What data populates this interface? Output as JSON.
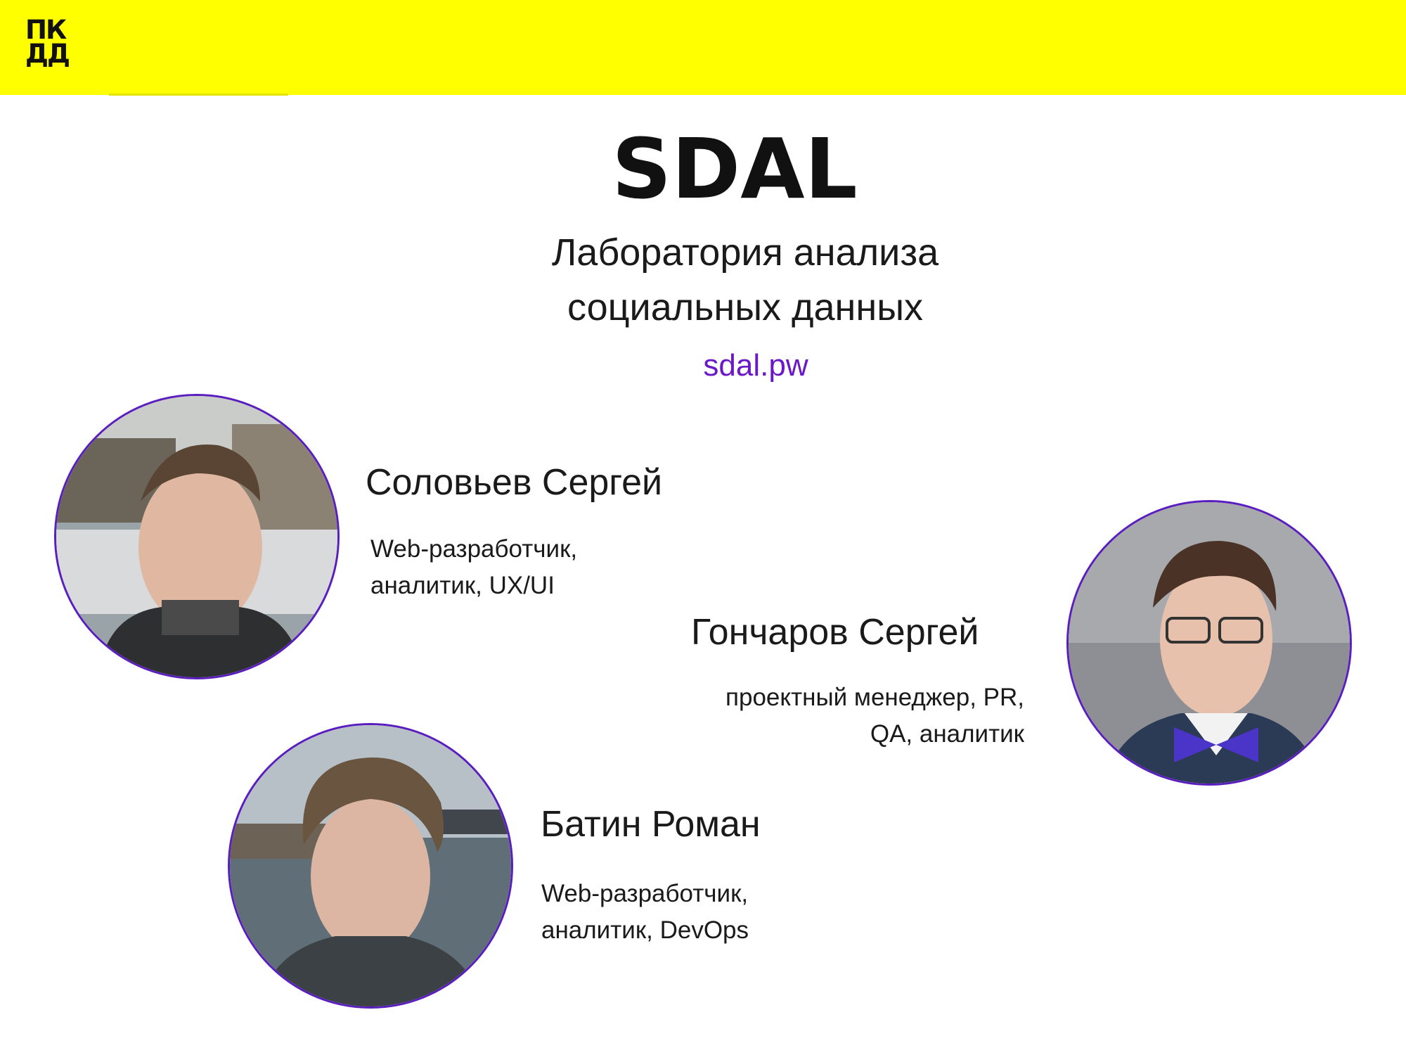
{
  "header": {
    "bar_color": "#ffff00",
    "logo": {
      "line1": "ПК",
      "line2": "ДД"
    }
  },
  "slide": {
    "title": "SDAL",
    "subtitle_line1": "Лаборатория анализа",
    "subtitle_line2": "социальных данных",
    "website": "sdal.pw",
    "website_color": "#6a18c8"
  },
  "team": [
    {
      "name": "Соловьев Сергей",
      "role_line1": "Web-разработчик,",
      "role_line2": "аналитик, UX/UI"
    },
    {
      "name": "Гончаров Сергей",
      "role_line1": "проектный менеджер, PR,",
      "role_line2": "QA, аналитик"
    },
    {
      "name": "Батин Роман",
      "role_line1": "Web-разработчик,",
      "role_line2": "аналитик, DevOps"
    }
  ],
  "accent_color": "#5a1dbf"
}
